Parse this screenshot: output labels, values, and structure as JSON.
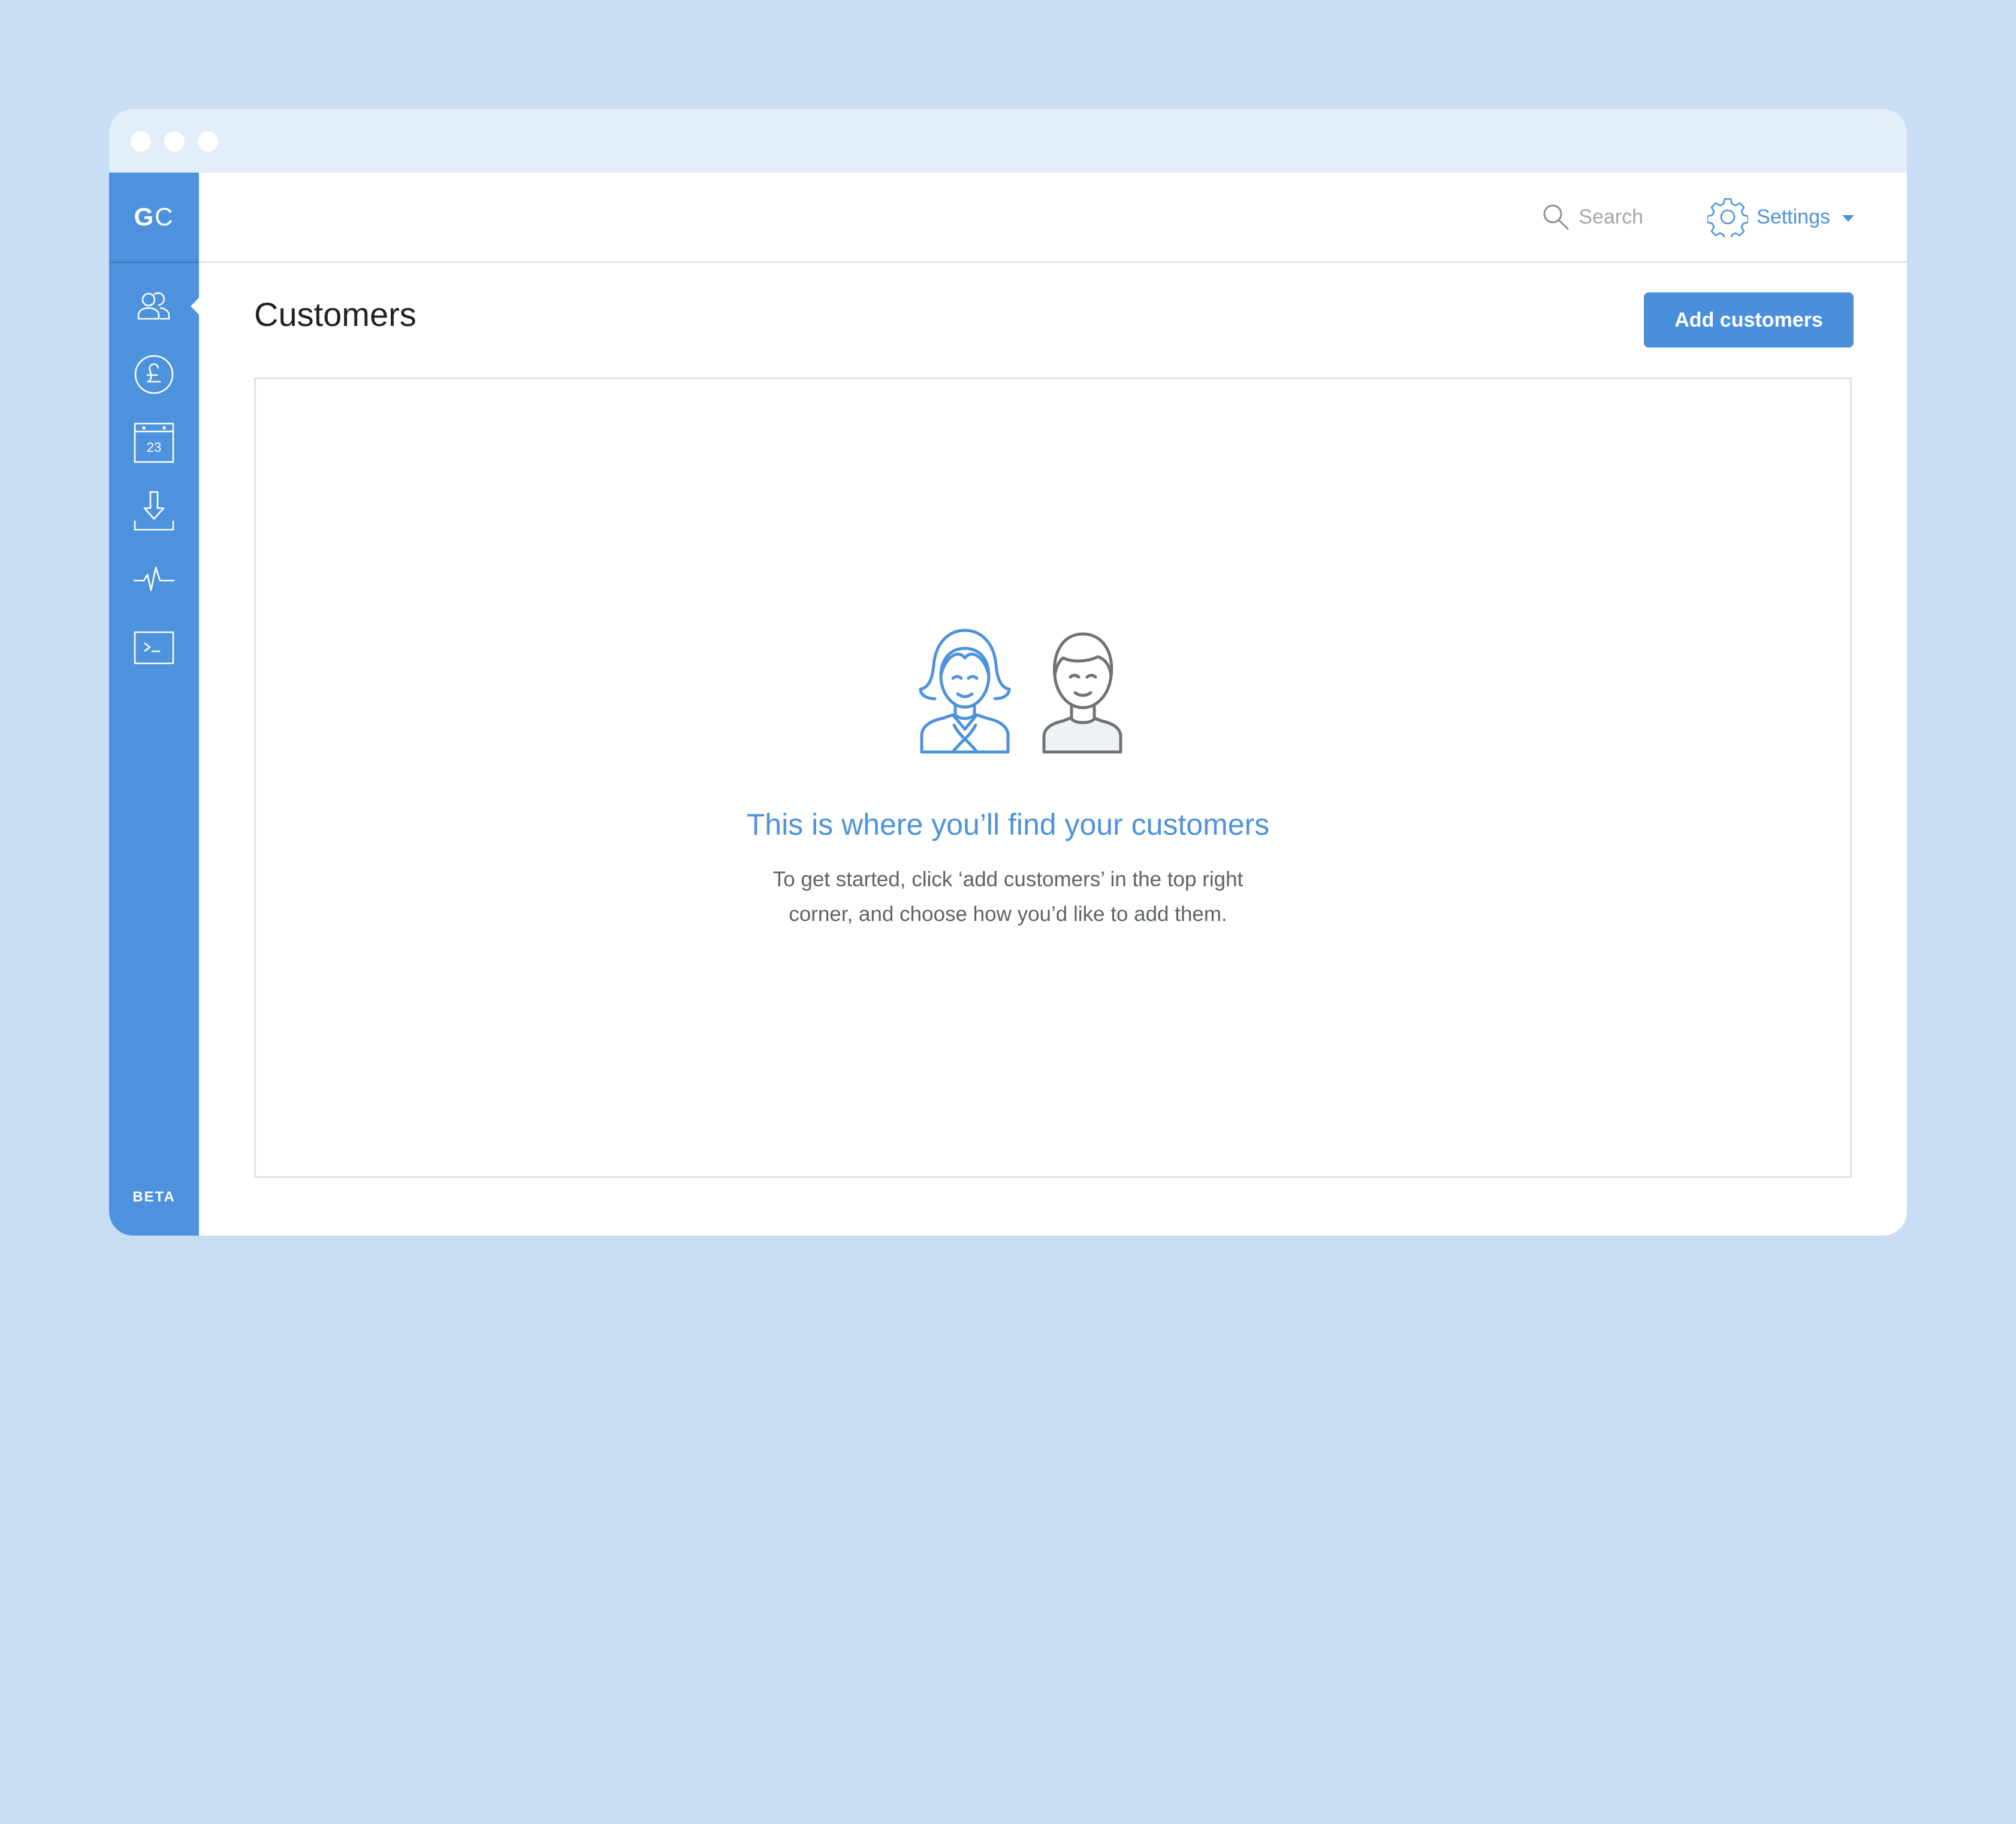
{
  "app": {
    "logo_g": "G",
    "logo_c": "C",
    "badge": "BETA"
  },
  "sidebar": {
    "items": [
      {
        "name": "customers",
        "icon": "people-icon",
        "active": true
      },
      {
        "name": "payments",
        "icon": "pound-icon",
        "active": false
      },
      {
        "name": "subscriptions",
        "icon": "calendar-icon",
        "active": false
      },
      {
        "name": "payouts",
        "icon": "download-icon",
        "active": false
      },
      {
        "name": "events",
        "icon": "pulse-icon",
        "active": false
      },
      {
        "name": "developers",
        "icon": "terminal-icon",
        "active": false
      }
    ],
    "calendar_day": "23"
  },
  "header": {
    "search_label": "Search",
    "settings_label": "Settings"
  },
  "main": {
    "title": "Customers",
    "add_button_label": "Add customers",
    "empty_state": {
      "title": "This is where you’ll find your customers",
      "line1": "To get started, click ‘add customers’ in the top right",
      "line2": "corner, and choose how you’d like to add them."
    }
  },
  "colors": {
    "background": "#c9ddf4",
    "sidebar": "#4d92dd",
    "accent": "#4a8fdc",
    "titlebar": "#e3edfa"
  }
}
